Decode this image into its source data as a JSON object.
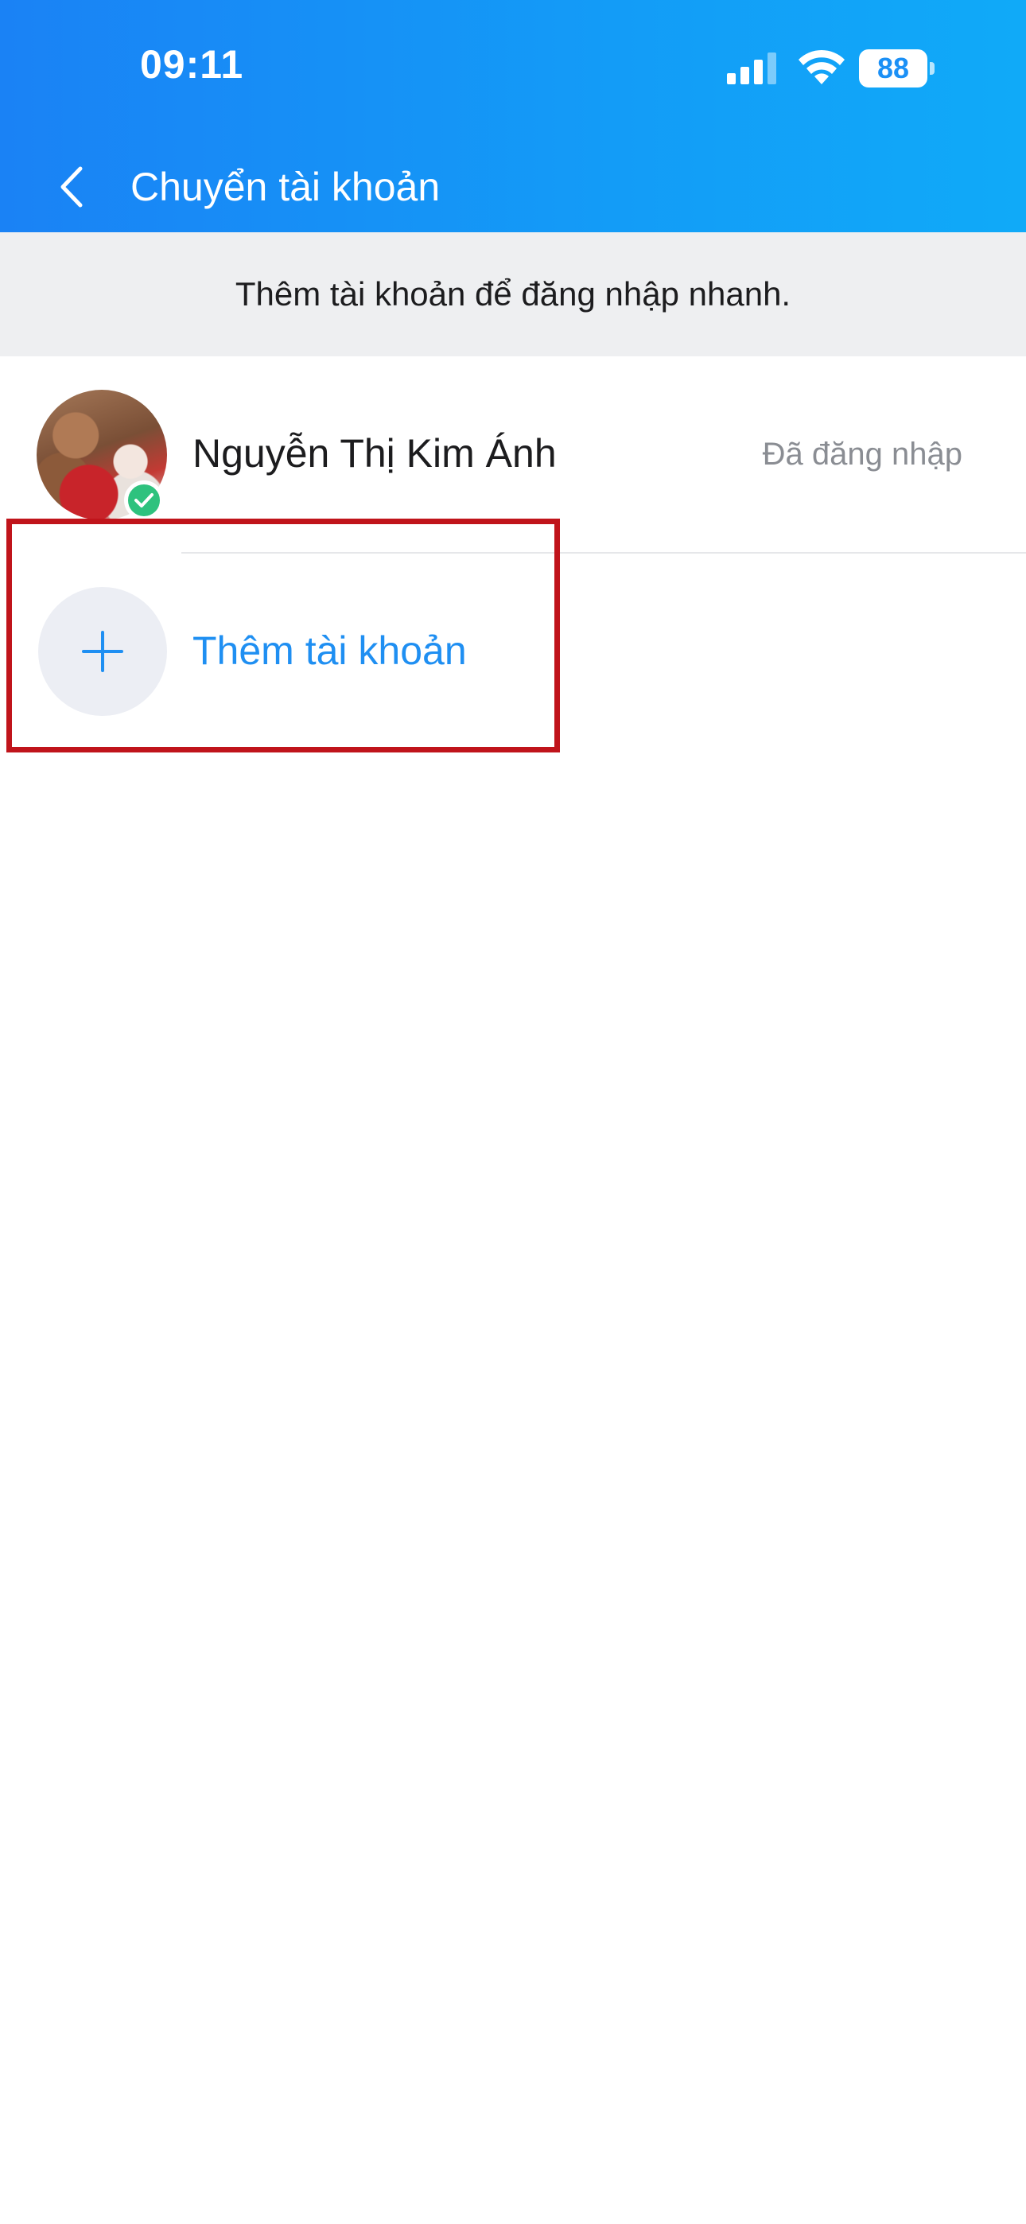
{
  "status_bar": {
    "time": "09:11",
    "battery_level": "88",
    "icons": [
      "signal-icon",
      "wifi-icon",
      "battery-icon"
    ]
  },
  "nav": {
    "back_icon": "chevron-left-icon",
    "title": "Chuyển tài khoản"
  },
  "banner": {
    "text": "Thêm tài khoản để đăng nhập nhanh."
  },
  "accounts": [
    {
      "name": "Nguyễn Thị Kim Ánh",
      "status": "Đã đăng nhập",
      "badge_icon": "check-icon"
    }
  ],
  "add_account": {
    "icon": "plus-icon",
    "label": "Thêm tài khoản"
  },
  "colors": {
    "header_blue": "#1a82f5",
    "link_blue": "#1f8ff2",
    "badge_green": "#2ec27e",
    "highlight_red": "#c0141b"
  }
}
